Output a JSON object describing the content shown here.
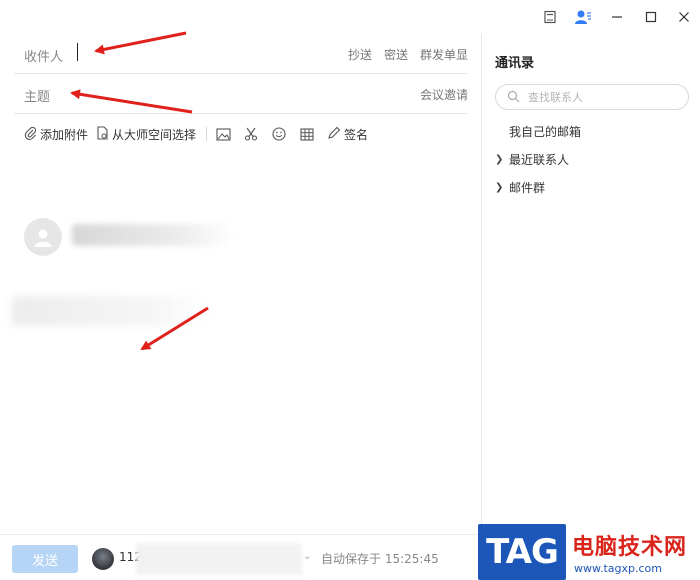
{
  "compose": {
    "recipient_label": "收件人",
    "recipient_actions": [
      "抄送",
      "密送",
      "群发单显"
    ],
    "subject_label": "主题",
    "subject_action": "会议邀请"
  },
  "toolbar": {
    "attach_label": "添加附件",
    "master_space_label": "从大师空间选择",
    "signature_label": "签名"
  },
  "bottom": {
    "send_label": "发送",
    "account_partial": "112",
    "autosave_text": "自动保存于 15:25:45"
  },
  "contacts": {
    "title": "通讯录",
    "search_placeholder": "查找联系人",
    "items": [
      {
        "label": "我自己的邮箱",
        "expandable": false
      },
      {
        "label": "最近联系人",
        "expandable": true
      },
      {
        "label": "邮件群",
        "expandable": true
      }
    ]
  },
  "watermark": {
    "logo_text": "TAG",
    "site_name": "电脑技术网",
    "url": "www.tagxp.com"
  },
  "colors": {
    "annotation_arrow": "#e0201b",
    "send_button": "#b6d4f6",
    "contact_icon": "#2f7cf6",
    "watermark_blue": "#1c56b8",
    "watermark_red": "#d9251c"
  },
  "icons": [
    "notepad-icon",
    "contacts-person-icon",
    "minimize-icon",
    "maximize-icon",
    "close-icon",
    "paperclip-icon",
    "document-icon",
    "image-icon",
    "scissors-icon",
    "emoji-icon",
    "table-icon",
    "pen-icon",
    "search-icon",
    "chevron-right-icon",
    "default-avatar-icon"
  ]
}
